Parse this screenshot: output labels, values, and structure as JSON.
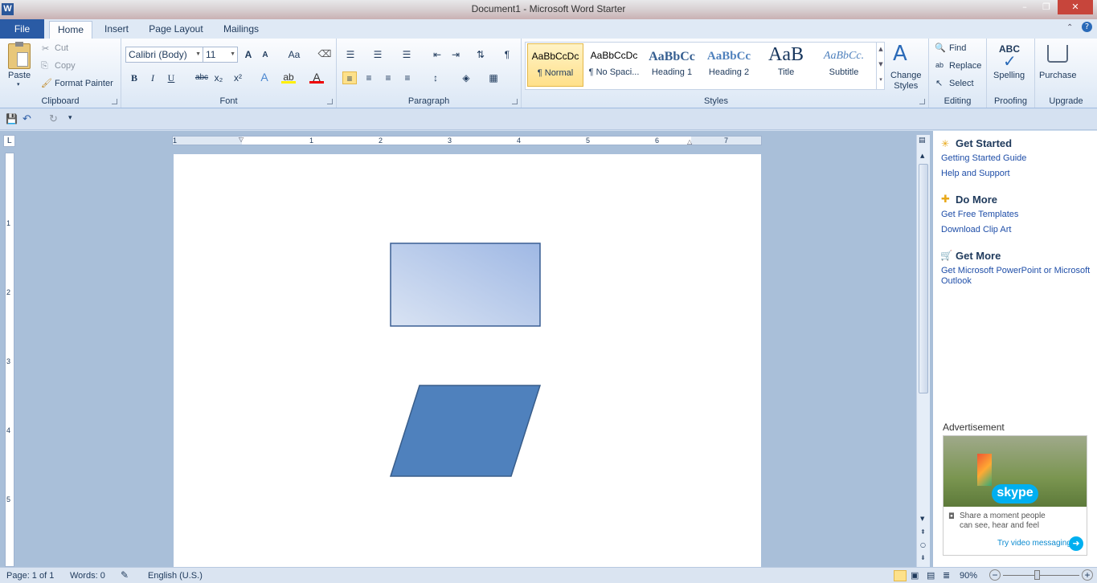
{
  "window": {
    "title": "Document1  -  Microsoft Word Starter",
    "app_letter": "W",
    "min": "–",
    "max": "❐",
    "close": "✕"
  },
  "tabs": {
    "file": "File",
    "home": "Home",
    "insert": "Insert",
    "page_layout": "Page Layout",
    "mailings": "Mailings"
  },
  "clipboard": {
    "paste": "Paste",
    "cut": "Cut",
    "copy": "Copy",
    "format_painter": "Format Painter",
    "label": "Clipboard"
  },
  "font": {
    "name": "Calibri (Body)",
    "size": "11",
    "label": "Font",
    "bold": "B",
    "italic": "I",
    "underline": "U",
    "strike": "abc",
    "sub": "x₂",
    "sup": "x²",
    "grow": "A",
    "shrink": "A",
    "case": "Aa"
  },
  "paragraph": {
    "label": "Paragraph",
    "pilcrow": "¶"
  },
  "styles": {
    "label": "Styles",
    "items": [
      {
        "preview": "AaBbCcDc",
        "name": "¶ Normal"
      },
      {
        "preview": "AaBbCcDc",
        "name": "¶ No Spaci..."
      },
      {
        "preview": "AaBbCc",
        "name": "Heading 1"
      },
      {
        "preview": "AaBbCc",
        "name": "Heading 2"
      },
      {
        "preview": "AaB",
        "name": "Title"
      },
      {
        "preview": "AaBbCc.",
        "name": "Subtitle"
      }
    ],
    "change_styles": "Change\nStyles"
  },
  "editing": {
    "label": "Editing",
    "find": "Find",
    "replace": "Replace",
    "select": "Select"
  },
  "proofing": {
    "label": "Proofing",
    "spelling": "Spelling",
    "abc": "ABC"
  },
  "upgrade": {
    "label": "Upgrade",
    "purchase": "Purchase"
  },
  "ruler": {
    "marks": [
      "1",
      "1",
      "2",
      "3",
      "4",
      "5",
      "6",
      "7"
    ],
    "vmarks": [
      "1",
      "2",
      "3",
      "4",
      "5"
    ]
  },
  "pane": {
    "get_started": "Get Started",
    "getting_started_guide": "Getting Started Guide",
    "help_support": "Help and Support",
    "do_more": "Do More",
    "free_templates": "Get Free Templates",
    "clip_art": "Download Clip Art",
    "get_more": "Get More",
    "get_ppt": "Get Microsoft PowerPoint or Microsoft Outlook",
    "ad_label": "Advertisement",
    "ad_brand": "skype",
    "ad_text": "Share a moment people can see, hear and feel",
    "ad_link": "Try video messaging"
  },
  "status": {
    "page": "Page: 1 of 1",
    "words": "Words: 0",
    "language": "English (U.S.)",
    "zoom": "90%",
    "minus": "−",
    "plus": "+"
  }
}
